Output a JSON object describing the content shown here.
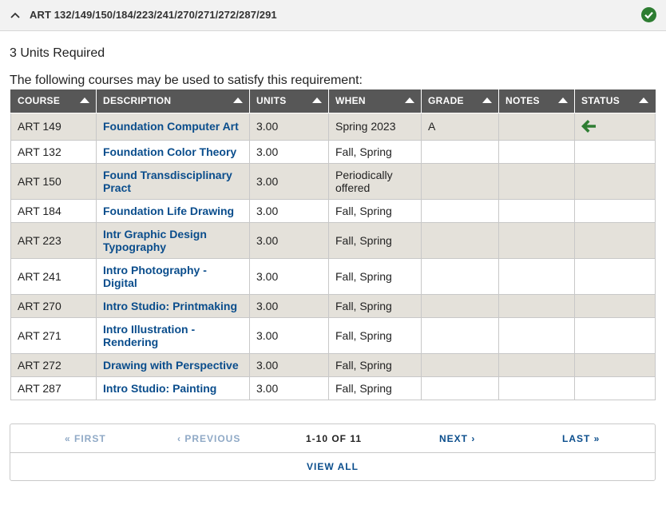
{
  "requirement": {
    "title": "ART 132/149/150/184/223/241/270/271/272/287/291",
    "units_required": "3 Units Required",
    "intro_text": "The following courses may be used to satisfy this requirement:",
    "collapse_icon": "chevron-up-icon",
    "status_icon": "check-circle-icon",
    "status_color": "#2e7d32"
  },
  "table": {
    "columns": [
      "COURSE",
      "DESCRIPTION",
      "UNITS",
      "WHEN",
      "GRADE",
      "NOTES",
      "STATUS"
    ],
    "rows": [
      {
        "course": "ART 149",
        "description": "Foundation Computer Art",
        "units": "3.00",
        "when": "Spring 2023",
        "grade": "A",
        "notes": "",
        "status_icon": "arrow-left-icon"
      },
      {
        "course": "ART 132",
        "description": "Foundation Color Theory",
        "units": "3.00",
        "when": "Fall, Spring",
        "grade": "",
        "notes": ""
      },
      {
        "course": "ART 150",
        "description": "Found Transdisciplinary Pract",
        "units": "3.00",
        "when": "Periodically offered",
        "grade": "",
        "notes": ""
      },
      {
        "course": "ART 184",
        "description": "Foundation Life Drawing",
        "units": "3.00",
        "when": "Fall, Spring",
        "grade": "",
        "notes": ""
      },
      {
        "course": "ART 223",
        "description": "Intr Graphic Design Typography",
        "units": "3.00",
        "when": "Fall, Spring",
        "grade": "",
        "notes": ""
      },
      {
        "course": "ART 241",
        "description": "Intro Photography - Digital",
        "units": "3.00",
        "when": "Fall, Spring",
        "grade": "",
        "notes": ""
      },
      {
        "course": "ART 270",
        "description": "Intro Studio: Printmaking",
        "units": "3.00",
        "when": "Fall, Spring",
        "grade": "",
        "notes": ""
      },
      {
        "course": "ART 271",
        "description": "Intro Illustration - Rendering",
        "units": "3.00",
        "when": "Fall, Spring",
        "grade": "",
        "notes": ""
      },
      {
        "course": "ART 272",
        "description": "Drawing with Perspective",
        "units": "3.00",
        "when": "Fall, Spring",
        "grade": "",
        "notes": ""
      },
      {
        "course": "ART 287",
        "description": "Intro Studio: Painting",
        "units": "3.00",
        "when": "Fall, Spring",
        "grade": "",
        "notes": ""
      }
    ],
    "status_arrow_color": "#2e7d32"
  },
  "pagination": {
    "first": "« FIRST",
    "previous": "‹ PREVIOUS",
    "current": "1-10 OF 11",
    "next": "NEXT ›",
    "last": "LAST »",
    "view_all": "VIEW ALL"
  }
}
